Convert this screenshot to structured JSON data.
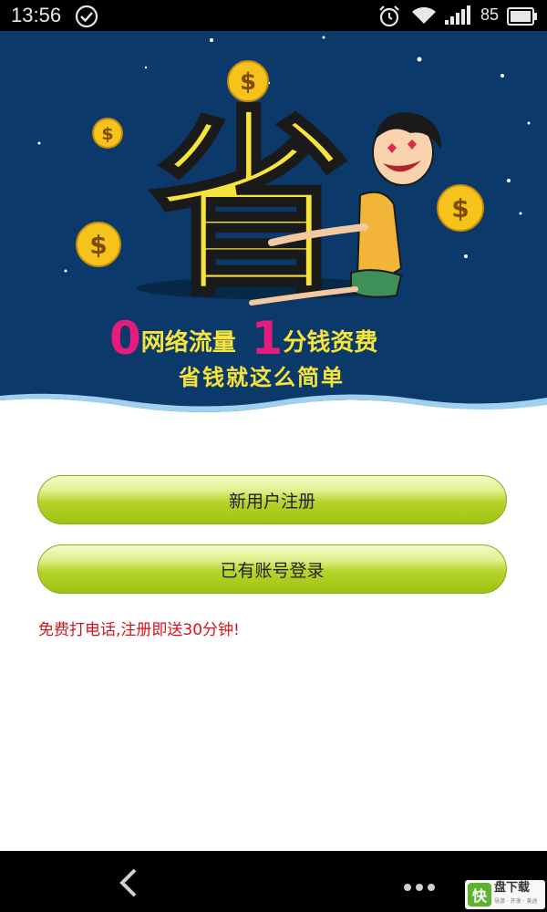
{
  "status_bar": {
    "time": "13:56",
    "battery": "85",
    "icons": [
      "check-circle-icon",
      "alarm-icon",
      "wifi-icon",
      "signal-icon",
      "battery-icon"
    ]
  },
  "banner": {
    "big_char": "省",
    "promo_zero": "0",
    "promo_text1": "网络流量",
    "promo_one": "1",
    "promo_text2": "分钱资费",
    "slogan": "省钱就这么简单",
    "coin_symbol": "$",
    "colors": {
      "sky": "#0b3a6a",
      "gold": "#f6e33b",
      "pink": "#e61b7d"
    }
  },
  "buttons": {
    "register": "新用户注册",
    "login": "已有账号登录"
  },
  "promo_note": "免费打电话,注册即送30分钟!",
  "nav_bar": {
    "icons": [
      "back-icon",
      "more-icon"
    ]
  },
  "watermark": {
    "badge": "快",
    "title": "盘下载",
    "sub": "导游 · 开发 · 美途"
  }
}
